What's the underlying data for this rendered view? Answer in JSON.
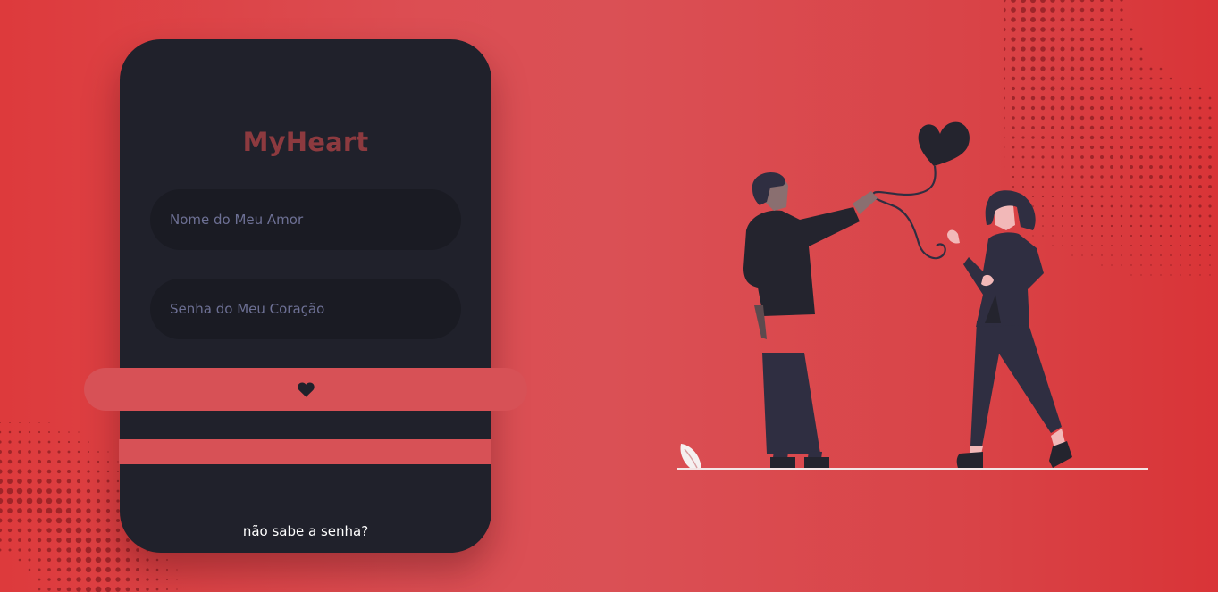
{
  "app": {
    "brand": "MyHeart"
  },
  "login": {
    "name_placeholder": "Nome do Meu Amor",
    "name_value": "",
    "password_placeholder": "Senha do Meu Coração",
    "password_value": "",
    "submit_icon": "heart-icon",
    "forgot_link": "não sabe a senha?"
  },
  "illustration": {
    "subject": "couple-with-heart-balloon"
  },
  "colors": {
    "background": "#dc4a4f",
    "card": "#20212b",
    "input": "#1a1b23",
    "brand_text": "#8d3a3f",
    "accent": "#d75156",
    "placeholder": "#6d7094",
    "link": "#ffffff"
  }
}
